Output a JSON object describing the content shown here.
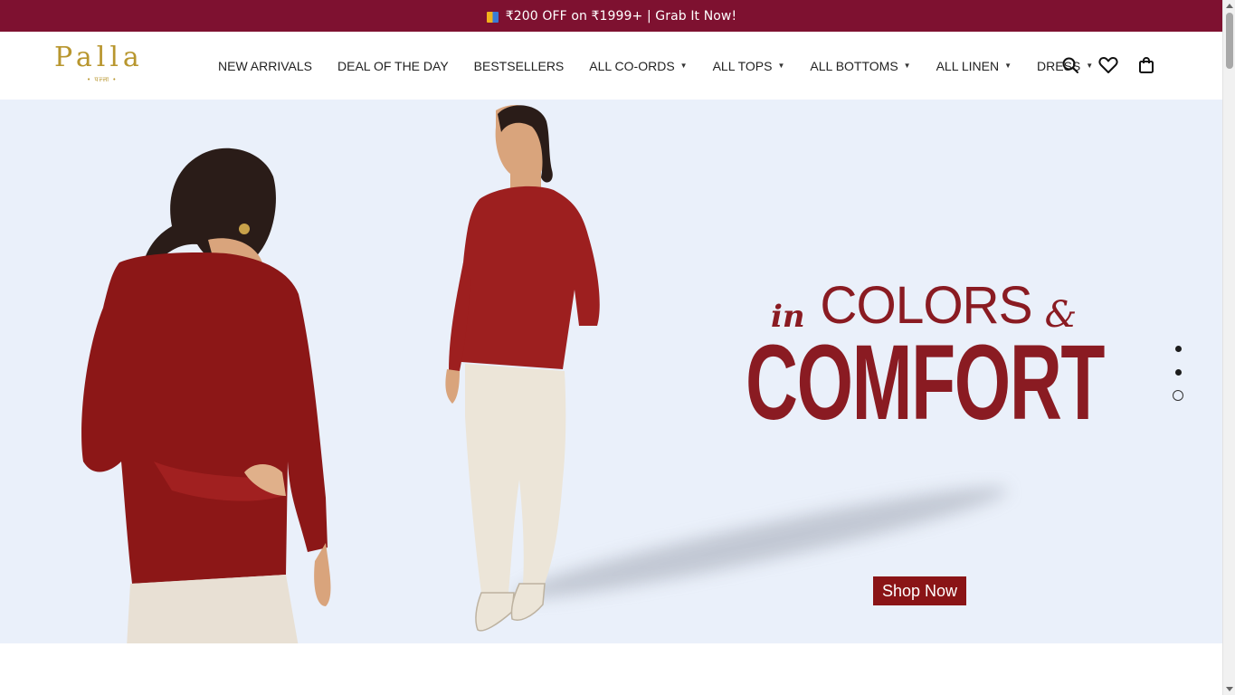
{
  "announcement": {
    "icon": "shopping-bag-emoji",
    "text": "₹200 OFF on ₹1999+ | Grab It Now!"
  },
  "brand": {
    "name": "Palla",
    "logo_word": "Palla",
    "logo_tagline": "• पल्ला •",
    "color": "#b8962e"
  },
  "nav": {
    "items": [
      {
        "label": "NEW ARRIVALS",
        "dropdown": false
      },
      {
        "label": "DEAL OF THE DAY",
        "dropdown": false
      },
      {
        "label": "BESTSELLERS",
        "dropdown": false
      },
      {
        "label": "ALL CO-ORDS",
        "dropdown": true
      },
      {
        "label": "ALL TOPS",
        "dropdown": true
      },
      {
        "label": "ALL BOTTOMS",
        "dropdown": true
      },
      {
        "label": "ALL LINEN",
        "dropdown": true
      },
      {
        "label": "DRESS",
        "dropdown": true
      }
    ]
  },
  "header_icons": [
    "search-icon",
    "wishlist-heart-icon",
    "cart-bag-icon"
  ],
  "hero": {
    "headline_small": "in",
    "headline_mid": "COLORS",
    "headline_amp": "&",
    "headline_big": "COMFORT",
    "cta": "Shop Now",
    "slides_count": 3,
    "active_slide": 3,
    "accent_color": "#8a1b22",
    "background_color": "#eaf0fa"
  },
  "colors": {
    "announcement_bar": "#7e1130",
    "cta_button": "#8a1416"
  }
}
